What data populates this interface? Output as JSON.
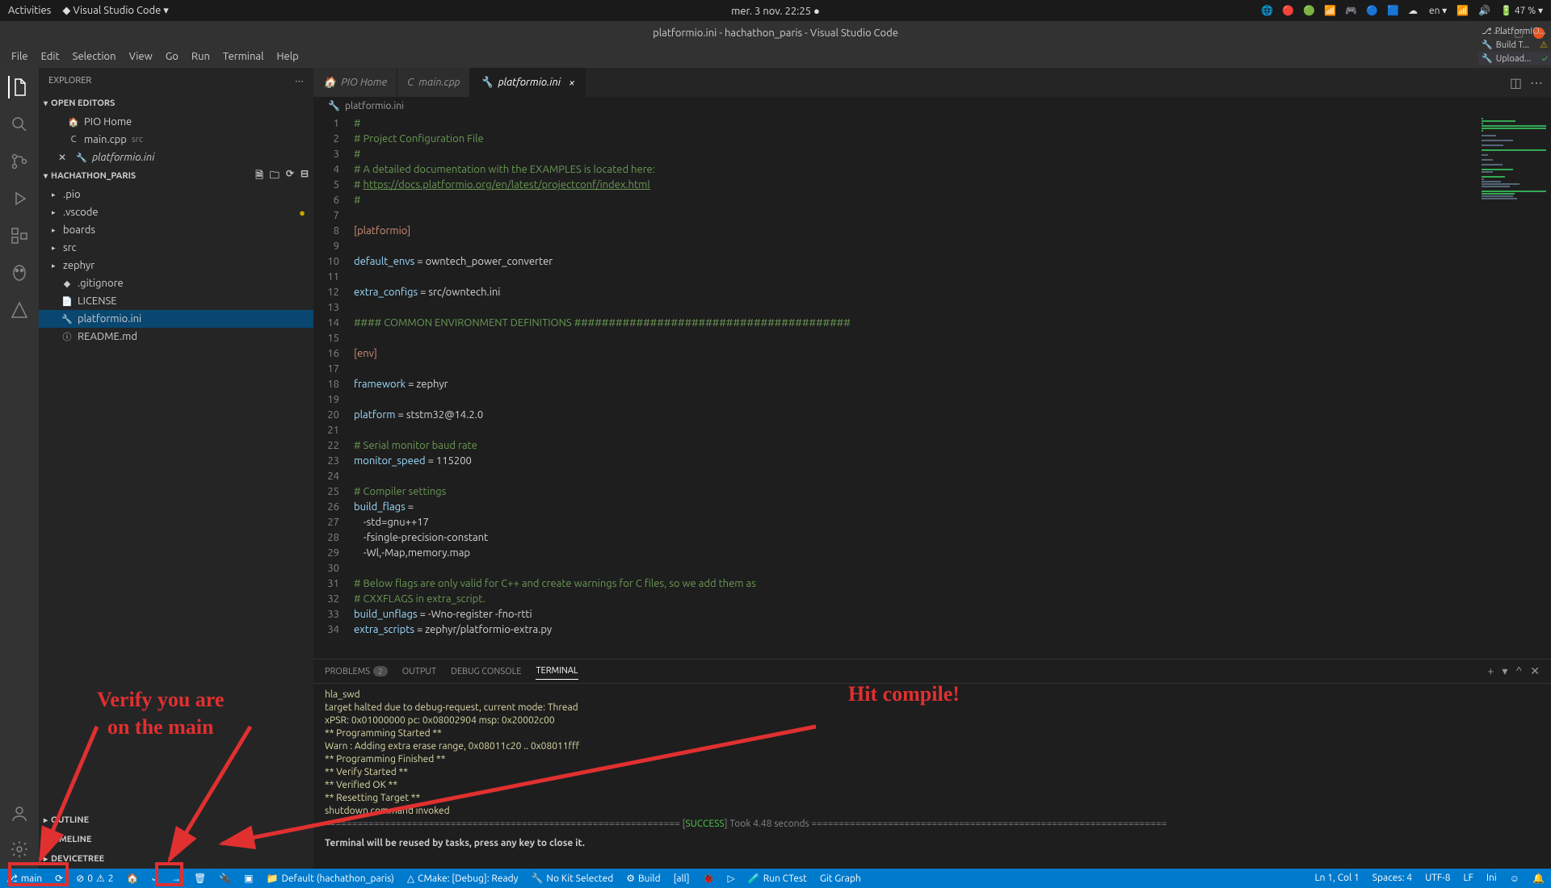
{
  "topbar": {
    "activities": "Activities",
    "app": "Visual Studio Code",
    "datetime": "mer. 3 nov.  22:25",
    "lang": "en",
    "battery": "47 %"
  },
  "window": {
    "title": "platformio.ini - hachathon_paris - Visual Studio Code"
  },
  "menu": [
    "File",
    "Edit",
    "Selection",
    "View",
    "Go",
    "Run",
    "Terminal",
    "Help"
  ],
  "explorer": {
    "title": "EXPLORER",
    "openEditors": "OPEN EDITORS",
    "project": "HACHATHON_PARIS",
    "editors": [
      {
        "icon": "🏠",
        "label": "PIO Home"
      },
      {
        "icon": "C",
        "label": "main.cpp",
        "hint": "src"
      },
      {
        "icon": "🔧",
        "label": "platformio.ini",
        "close": true,
        "italic": true
      }
    ],
    "tree": [
      {
        "type": "folder",
        "label": ".pio"
      },
      {
        "type": "folder",
        "label": ".vscode",
        "dot": true
      },
      {
        "type": "folder",
        "label": "boards"
      },
      {
        "type": "folder",
        "label": "src"
      },
      {
        "type": "folder",
        "label": "zephyr"
      },
      {
        "type": "file",
        "icon": "◆",
        "label": ".gitignore"
      },
      {
        "type": "file",
        "icon": "📄",
        "label": "LICENSE"
      },
      {
        "type": "file",
        "icon": "🔧",
        "label": "platformio.ini",
        "selected": true
      },
      {
        "type": "file",
        "icon": "ⓘ",
        "label": "README.md"
      }
    ],
    "outline": "OUTLINE",
    "timeline": "TIMELINE",
    "devicetree": "DEVICETREE"
  },
  "tabs": [
    {
      "icon": "🏠",
      "label": "PIO Home"
    },
    {
      "icon": "C",
      "label": "main.cpp"
    },
    {
      "icon": "🔧",
      "label": "platformio.ini",
      "active": true,
      "close": true
    }
  ],
  "breadcrumb": {
    "icon": "🔧",
    "label": "platformio.ini"
  },
  "code": [
    {
      "n": 1,
      "t": "#",
      "c": "c-comment"
    },
    {
      "n": 2,
      "t": "# Project Configuration File",
      "c": "c-comment"
    },
    {
      "n": 3,
      "t": "#",
      "c": "c-comment"
    },
    {
      "n": 4,
      "t": "# A detailed documentation with the EXAMPLES is located here:",
      "c": "c-comment"
    },
    {
      "n": 5,
      "pre": "# ",
      "link": "https://docs.platformio.org/en/latest/projectconf/index.html"
    },
    {
      "n": 6,
      "t": "#",
      "c": "c-comment"
    },
    {
      "n": 7,
      "t": ""
    },
    {
      "n": 8,
      "t": "[platformio]",
      "c": "c-section"
    },
    {
      "n": 9,
      "t": ""
    },
    {
      "n": 10,
      "key": "default_envs",
      "val": " = owntech_power_converter"
    },
    {
      "n": 11,
      "t": ""
    },
    {
      "n": 12,
      "key": "extra_configs",
      "val": " = src/owntech.ini"
    },
    {
      "n": 13,
      "t": ""
    },
    {
      "n": 14,
      "t": "#### COMMON ENVIRONMENT DEFINITIONS ########################################",
      "c": "c-comment"
    },
    {
      "n": 15,
      "t": ""
    },
    {
      "n": 16,
      "t": "[env]",
      "c": "c-section"
    },
    {
      "n": 17,
      "t": ""
    },
    {
      "n": 18,
      "key": "framework",
      "val": " = zephyr"
    },
    {
      "n": 19,
      "t": ""
    },
    {
      "n": 20,
      "key": "platform",
      "val": " = ststm32@14.2.0"
    },
    {
      "n": 21,
      "t": ""
    },
    {
      "n": 22,
      "t": "# Serial monitor baud rate",
      "c": "c-comment"
    },
    {
      "n": 23,
      "key": "monitor_speed",
      "val": " = 115200"
    },
    {
      "n": 24,
      "t": ""
    },
    {
      "n": 25,
      "t": "# Compiler settings",
      "c": "c-comment"
    },
    {
      "n": 26,
      "key": "build_flags",
      "val": " ="
    },
    {
      "n": 27,
      "t": "    -std=gnu++17"
    },
    {
      "n": 28,
      "t": "    -fsingle-precision-constant"
    },
    {
      "n": 29,
      "t": "    -Wl,-Map,memory.map"
    },
    {
      "n": 30,
      "t": ""
    },
    {
      "n": 31,
      "t": "# Below flags are only valid for C++ and create warnings for C files, so we add them as",
      "c": "c-comment"
    },
    {
      "n": 32,
      "t": "# CXXFLAGS in extra_script.",
      "c": "c-comment"
    },
    {
      "n": 33,
      "key": "build_unflags",
      "val": " = -Wno-register -fno-rtti"
    },
    {
      "n": 34,
      "key": "extra_scripts",
      "val": " = zephyr/platformio-extra.py"
    }
  ],
  "panel": {
    "problems": "PROBLEMS",
    "problemsCount": "2",
    "output": "OUTPUT",
    "debug": "DEBUG CONSOLE",
    "terminal": "TERMINAL",
    "lines": [
      {
        "t": "hla_swd",
        "c": "term-yellow"
      },
      {
        "t": "target halted due to debug-request, current mode: Thread",
        "c": "term-yellow"
      },
      {
        "t": "xPSR: 0x01000000 pc: 0x08002904 msp: 0x20002c00",
        "c": "term-yellow"
      },
      {
        "t": "** Programming Started **",
        "c": "term-yellow"
      },
      {
        "t": "Warn : Adding extra erase range, 0x08011c20 .. 0x08011fff",
        "c": "term-yellow"
      },
      {
        "t": "** Programming Finished **",
        "c": "term-yellow"
      },
      {
        "t": "** Verify Started **",
        "c": "term-yellow"
      },
      {
        "t": "** Verified OK **",
        "c": "term-yellow"
      },
      {
        "t": "** Resetting Target **",
        "c": "term-yellow"
      },
      {
        "t": "shutdown command invoked",
        "c": "term-yellow"
      }
    ],
    "successLine": {
      "pre": "================================================================= [",
      "success": "SUCCESS",
      "post": "] Took 4.48 seconds ================================================================="
    },
    "reuse": "Terminal will be reused by tasks, press any key to close it.",
    "side": [
      {
        "icon": "⎇",
        "label": "PlatformIO..."
      },
      {
        "icon": "🔧",
        "label": "Build T...",
        "warn": "⚠"
      },
      {
        "icon": "🔧",
        "label": "Upload...",
        "ok": "✓",
        "selected": true
      }
    ]
  },
  "status": {
    "branch": "main",
    "errors": "0",
    "warnings": "2",
    "items": [
      "Default (hachathon_paris)",
      "CMake: [Debug]: Ready",
      "No Kit Selected",
      "Build",
      "[all]",
      "Run CTest",
      "Git Graph"
    ],
    "right": [
      "Ln 1, Col 1",
      "Spaces: 4",
      "UTF-8",
      "LF",
      "Ini"
    ]
  },
  "annotations": {
    "verify": "Verify you are on the main",
    "compile": "Hit compile!"
  }
}
